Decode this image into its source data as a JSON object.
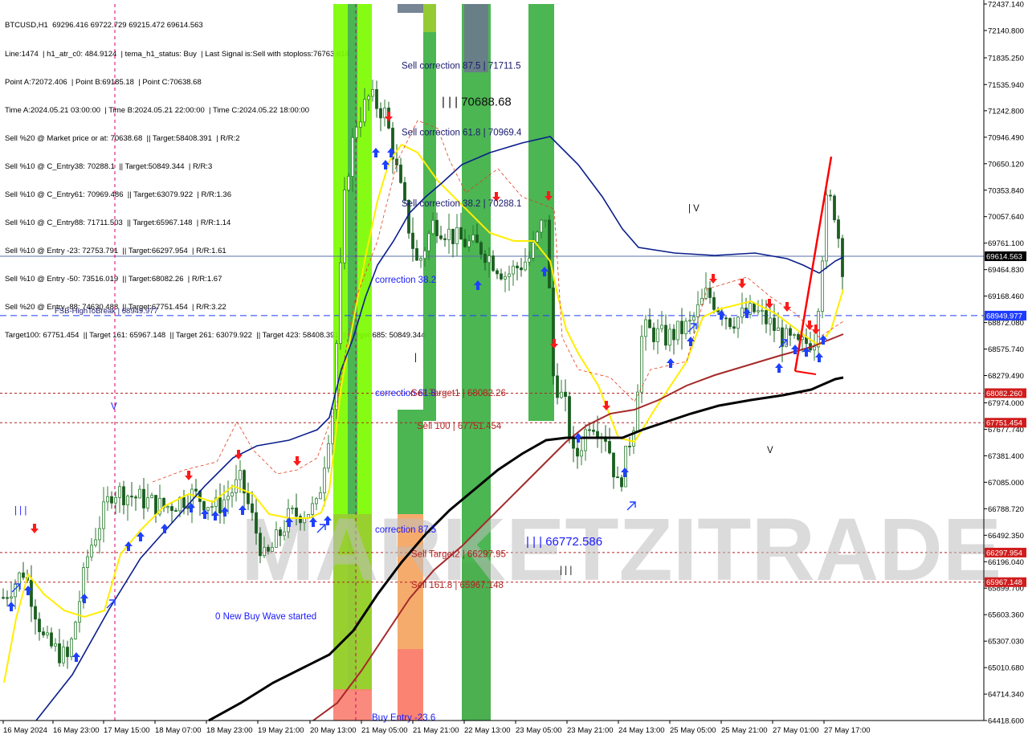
{
  "header_lines": [
    "BTCUSD,H1  69296.416 69722.729 69215.472 69614.563",
    "Line:1474  | h1_atr_c0: 484.9124  | tema_h1_status: Buy  | Last Signal is:Sell with stoploss:76763.616",
    "Point A:72072.406  | Point B:69185.18  | Point C:70638.68",
    "Time A:2024.05.21 03:00:00  | Time B:2024.05.21 22:00:00  | Time C:2024.05.22 18:00:00",
    "Sell %20 @ Market price or at: 70638.68  || Target:58408.391  | R/R:2",
    "Sell %10 @ C_Entry38: 70288.1  || Target:50849.344  | R/R:3",
    "Sell %10 @ C_Entry61: 70969.486  || Target:63079.922  | R/R:1.36",
    "Sell %10 @ C_Entry88: 71711.503  || Target:65967.148  | R/R:1.14",
    "Sell %10 @ Entry -23: 72753.791  || Target:66297.954  | R/R:1.61",
    "Sell %10 @ Entry -50: 73516.019  || Target:68082.26  | R/R:1.67",
    "Sell %20 @ Entry -88: 74630.488  || Target:67751.454  | R/R:3.22",
    "Target100: 67751.454  || Target 161: 65967.148  || Target 261: 63079.922  || Target 423: 58408.391  || Target 685: 50849.344"
  ],
  "watermark": "MARKETZITRADE",
  "colors": {
    "bg": "#ffffff",
    "up_candle": "#2e7d32",
    "down_candle": "#1b5e20",
    "ma_yellow": "#ffee00",
    "ma_navy": "#0a1e8c",
    "ma_brown": "#a52a2a",
    "ma_black": "#000000",
    "green_zone": "#3cb043",
    "lime_zone": "#7cfc00",
    "orange_zone": "#f4a460",
    "red_zone": "#fa8072",
    "gray_zone": "#6b7b8c",
    "buy_arrow": "#1e40ff",
    "sell_arrow": "#ff1a1a",
    "price_line": "#1f3a8f",
    "red_level": "#b22222"
  },
  "chart_data": {
    "type": "candlestick",
    "symbol": "BTCUSD",
    "timeframe": "H1",
    "ylim": [
      64418.6,
      72437.14
    ],
    "y_ticks": [
      "72437.140",
      "72140.800",
      "71835.250",
      "71535.940",
      "71242.800",
      "70946.490",
      "70650.120",
      "70353.840",
      "70057.640",
      "69761.100",
      "69464.830",
      "69168.460",
      "68872.080",
      "68575.740",
      "68279.490",
      "67974.000",
      "67677.740",
      "67381.400",
      "67085.000",
      "66788.720",
      "66492.350",
      "66196.040",
      "65899.700",
      "65603.360",
      "65307.030",
      "65010.680",
      "64714.340",
      "64418.600"
    ],
    "x_ticks": [
      "16 May 2024",
      "16 May 23:00",
      "17 May 15:00",
      "18 May 07:00",
      "18 May 23:00",
      "19 May 21:00",
      "20 May 13:00",
      "21 May 05:00",
      "21 May 21:00",
      "22 May 13:00",
      "23 May 05:00",
      "23 May 21:00",
      "24 May 13:00",
      "25 May 05:00",
      "25 May 21:00",
      "27 May 01:00",
      "27 May 17:00"
    ],
    "current_price": "69614.563",
    "price_tags": [
      {
        "value": 69614.563,
        "label": "69614.563",
        "bg": "#000000",
        "fg": "#ffffff"
      },
      {
        "value": 68949.977,
        "label": "68949.977",
        "bg": "#1e3cff",
        "fg": "#ffffff"
      },
      {
        "value": 68082.26,
        "label": "68082.260",
        "bg": "#d01c1c",
        "fg": "#ffffff"
      },
      {
        "value": 67751.454,
        "label": "67751.454",
        "bg": "#d01c1c",
        "fg": "#ffffff"
      },
      {
        "value": 66297.954,
        "label": "66297.954",
        "bg": "#d01c1c",
        "fg": "#ffffff"
      },
      {
        "value": 65967.148,
        "label": "65967.148",
        "bg": "#d01c1c",
        "fg": "#ffffff"
      }
    ],
    "horizontal_levels": [
      {
        "value": 69614.563,
        "style": "solid",
        "color": "#5a6fa8"
      },
      {
        "value": 68949.977,
        "style": "dashed",
        "color": "#1e3cff",
        "label": "FSB-HighToBreak | 68949.977"
      },
      {
        "value": 68082.26,
        "style": "dotted",
        "color": "#b22222"
      },
      {
        "value": 67751.454,
        "style": "dotted",
        "color": "#b22222"
      },
      {
        "value": 66297.954,
        "style": "dotted",
        "color": "#b22222"
      },
      {
        "value": 65967.148,
        "style": "dotted",
        "color": "#b22222"
      }
    ],
    "annotations": [
      {
        "text": "Sell correction 87.5 | 71711.5",
        "color": "#1a1a6e",
        "value": 71711.5
      },
      {
        "text": "| | | 70688.68",
        "color": "#111111",
        "value": 71300.0,
        "large": true
      },
      {
        "text": "Sell correction 61.8 | 70969.4",
        "color": "#1a1a6e",
        "value": 70969.4
      },
      {
        "text": "Sell correction 38.2 | 70288.1",
        "color": "#1a1a6e",
        "value": 70170.0
      },
      {
        "text": "correction 38.2",
        "color": "#1a1aff",
        "value": 69320.0
      },
      {
        "text": "correction 61.8",
        "color": "#1a1aff",
        "value": 68050.0
      },
      {
        "text": "Sell Target1 | 68082.26",
        "color": "#b22222",
        "value": 68050.0
      },
      {
        "text": "Sell 100 | 67751.454",
        "color": "#b22222",
        "value": 67680.0
      },
      {
        "text": "correction 87.5",
        "color": "#1a1aff",
        "value": 66520.0
      },
      {
        "text": "| | | 66772.586",
        "color": "#1a1aff",
        "value": 66380.0,
        "large": true
      },
      {
        "text": "Sell Target2 | 66297.95",
        "color": "#b22222",
        "value": 66250.0
      },
      {
        "text": "Sell 161.8 | 65967.148",
        "color": "#b22222",
        "value": 65900.0
      },
      {
        "text": "0 New Buy Wave started",
        "color": "#1a1aff",
        "value": 65550.0
      },
      {
        "text": "Buy Entry -23.6",
        "color": "#1a1aff",
        "value": 64420.0
      },
      {
        "text": "| | |",
        "color": "#1a1aff",
        "value": 66740.0
      },
      {
        "text": "| V",
        "color": "#111111",
        "value": 70120.0
      },
      {
        "text": "V",
        "color": "#111111",
        "value": 67410.0
      },
      {
        "text": "| | |",
        "color": "#111111",
        "value": 66070.0
      },
      {
        "text": "|",
        "color": "#111111",
        "value": 68450.0
      },
      {
        "text": "V",
        "color": "#1a1aff",
        "value": 67900.0
      }
    ]
  }
}
